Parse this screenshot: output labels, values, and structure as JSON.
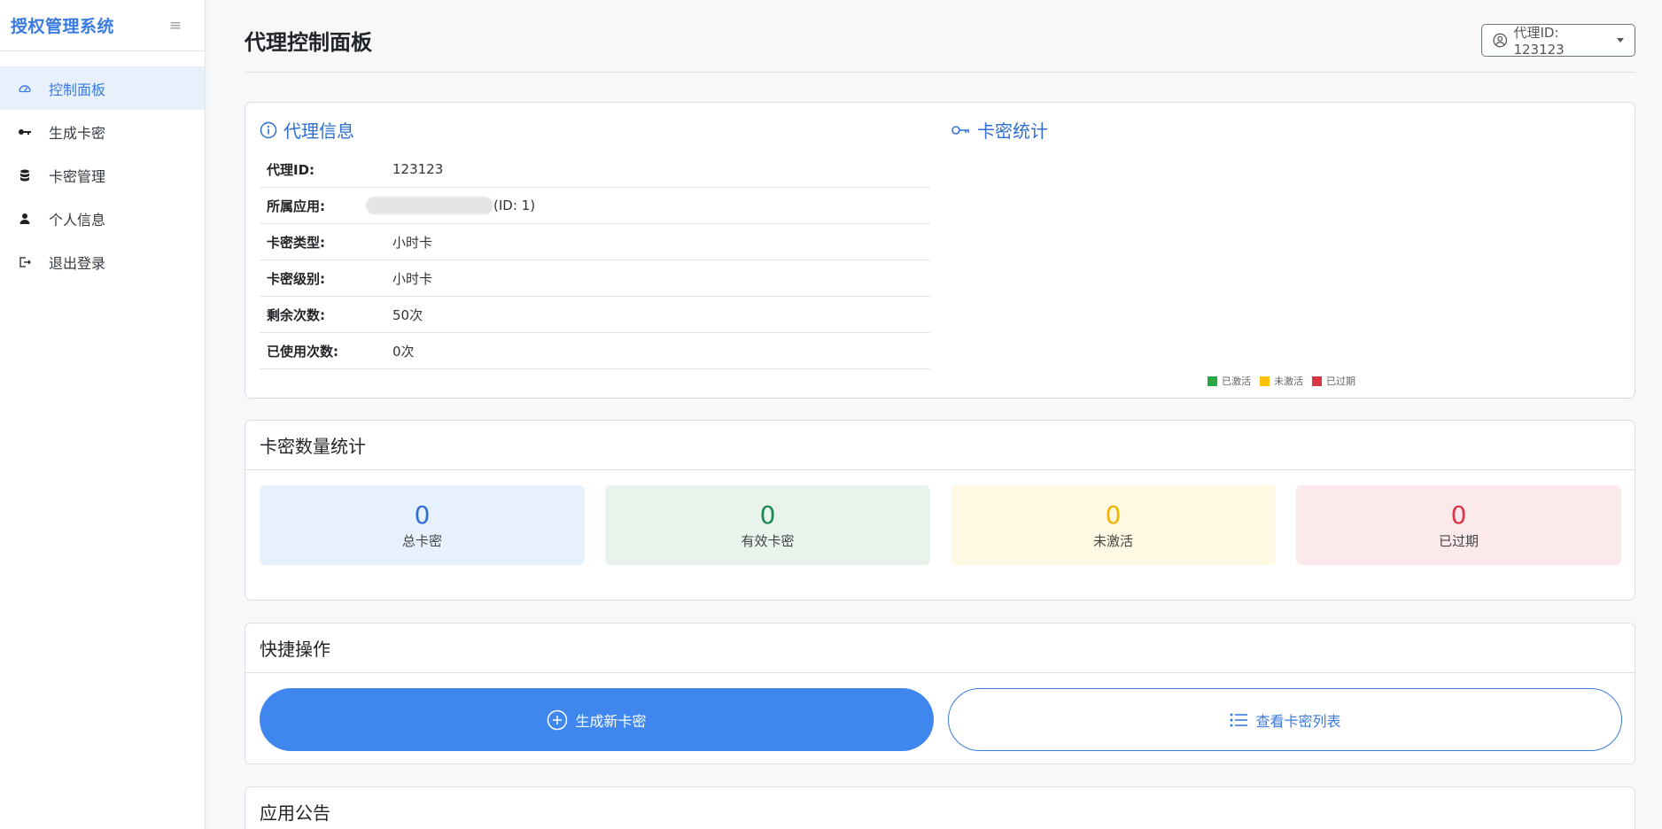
{
  "sidebar": {
    "title": "授权管理系统",
    "toggle_icon": "hamburger-icon",
    "items": [
      {
        "label": "控制面板",
        "icon": "dashboard-gauge-icon",
        "active": true
      },
      {
        "label": "生成卡密",
        "icon": "key-icon",
        "active": false
      },
      {
        "label": "卡密管理",
        "icon": "database-icon",
        "active": false
      },
      {
        "label": "个人信息",
        "icon": "user-icon",
        "active": false
      },
      {
        "label": "退出登录",
        "icon": "logout-icon",
        "active": false
      }
    ]
  },
  "header": {
    "title": "代理控制面板",
    "agent_button": "代理ID: 123123",
    "agent_icon": "user-circle-icon"
  },
  "agent_info": {
    "title": "代理信息",
    "rows": [
      {
        "label": "代理ID:",
        "value": "123123"
      },
      {
        "label": "所属应用:",
        "value": "(ID: 1)"
      },
      {
        "label": "卡密类型:",
        "value": "小时卡"
      },
      {
        "label": "卡密级别:",
        "value": "小时卡"
      },
      {
        "label": "剩余次数:",
        "value": "50次"
      },
      {
        "label": "已使用次数:",
        "value": "0次"
      }
    ]
  },
  "card_stats": {
    "title": "卡密统计",
    "legend": [
      {
        "label": "已激活",
        "color": "#28a745"
      },
      {
        "label": "未激活",
        "color": "#ffc107"
      },
      {
        "label": "已过期",
        "color": "#dc3545"
      }
    ]
  },
  "count_stats": {
    "title": "卡密数量统计",
    "boxes": [
      {
        "value": "0",
        "label": "总卡密",
        "color": "#2f6fd0",
        "bg": "#e7f1fd"
      },
      {
        "value": "0",
        "label": "有效卡密",
        "color": "#198754",
        "bg": "#e8f3ec"
      },
      {
        "value": "0",
        "label": "未激活",
        "color": "#f0b400",
        "bg": "#fff8e3"
      },
      {
        "value": "0",
        "label": "已过期",
        "color": "#dc3545",
        "bg": "#fbe9eb"
      }
    ]
  },
  "quick_actions": {
    "title": "快捷操作",
    "generate": "生成新卡密",
    "view_list": "查看卡密列表"
  },
  "notice": {
    "title": "应用公告"
  }
}
